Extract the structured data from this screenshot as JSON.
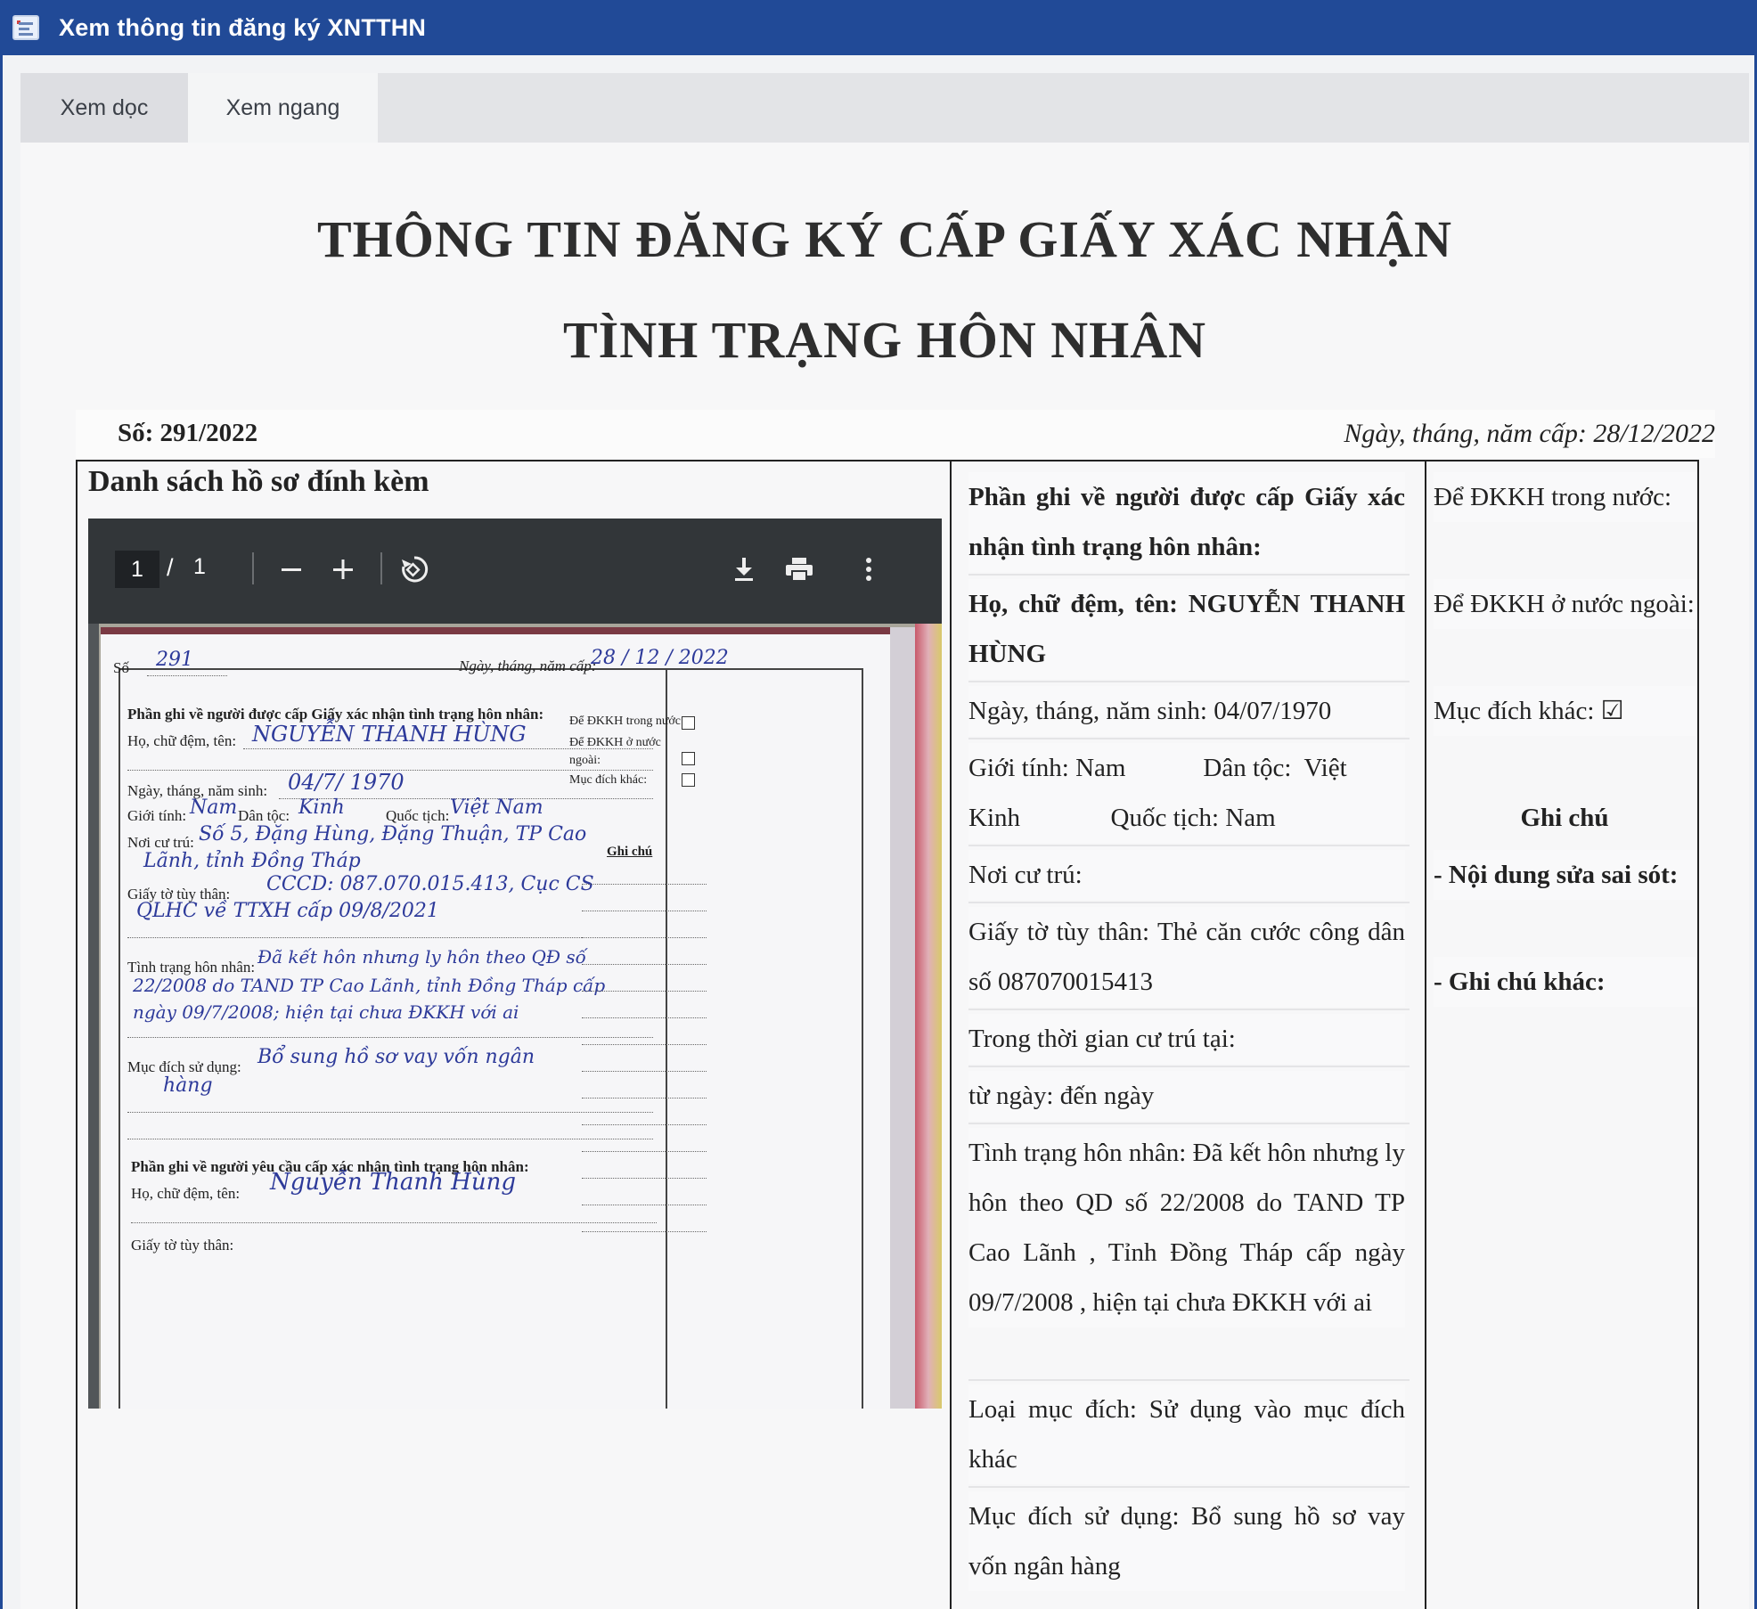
{
  "window": {
    "title": "Xem thông tin đăng ký XNTTHN"
  },
  "tabs": [
    {
      "label": "Xem dọc"
    },
    {
      "label": "Xem ngang"
    }
  ],
  "document": {
    "title_line1": "THÔNG TIN ĐĂNG KÝ CẤP GIẤY XÁC NHẬN",
    "title_line2": "TÌNH TRẠNG HÔN NHÂN",
    "so": "Số: 291/2022",
    "issue_date": "Ngày, tháng, năm cấp:  28/12/2022",
    "attachments_title": "Danh sách hồ sơ đính kèm"
  },
  "pdf_viewer": {
    "page_current": "1",
    "page_sep": "/",
    "page_total": "1",
    "icons": [
      "zoom-out-icon",
      "zoom-in-icon",
      "rotate-icon",
      "download-icon",
      "print-icon",
      "more-options-icon"
    ],
    "scan": {
      "so_label": "Số",
      "so_value": "291",
      "date_label": "Ngày, tháng, năm cấp:",
      "date_value": "28 / 12 / 2022",
      "section1": "Phần ghi về người được cấp Giấy xác nhận tình trạng hôn nhân:",
      "name_label": "Họ, chữ đệm, tên:",
      "name_value": "NGUYỄN THANH HÙNG",
      "dkkh_in": "Để ĐKKH trong nước:",
      "dkkh_out": "Để ĐKKH ở nước",
      "dkkh_out2": "ngoài:",
      "other_purpose": "Mục đích khác:",
      "dob_label": "Ngày, tháng, năm sinh:",
      "dob_value": "04/7/ 1970",
      "gender_label": "Giới tính:",
      "gender_value": "Nam",
      "ethnic_label": "Dân tộc:",
      "ethnic_value": "Kinh",
      "nation_label": "Quốc tịch:",
      "nation_value": "Việt Nam",
      "residence_label": "Nơi cư trú:",
      "residence_line1": "Số 5, Đặng Hùng, Đặng Thuận, TP Cao",
      "residence_line2": "Lãnh, tỉnh Đồng Tháp",
      "ghichu_label": "Ghi chú",
      "id_label": "Giấy tờ tùy thân:",
      "id_line1": "CCCD: 087.070.015.413, Cục CS",
      "id_line2": "QLHC về TTXH cấp 09/8/2021",
      "marital_label": "Tình trạng hôn nhân:",
      "marital_line1": "Đã kết hôn nhưng ly hôn theo QĐ số",
      "marital_line2": "22/2008 do TAND TP Cao Lãnh, tỉnh Đồng Tháp cấp",
      "marital_line3": "ngày 09/7/2008; hiện tại chưa ĐKKH với ai",
      "purpose_label": "Mục đích sử dụng:",
      "purpose_line1": "Bổ sung hồ sơ vay vốn ngân",
      "purpose_line2": "hàng",
      "section2": "Phần ghi về người yêu cầu cấp xác nhận tình trạng hôn nhân:",
      "req_name_label": "Họ, chữ đệm, tên:",
      "req_name_value": "Nguyễn Thanh Hùng",
      "req_id_label": "Giấy tờ tùy thân:"
    }
  },
  "info": {
    "section_title": "Phần ghi về người được cấp Giấy xác nhận tình trạng hôn nhân:",
    "name": "Họ, chữ đệm, tên: NGUYỄN THANH HÙNG",
    "dob": "Ngày, tháng, năm sinh: 04/07/1970",
    "gender_line1": "Giới tính: Nam            Dân tộc:  Việt",
    "gender_line2": "Kinh              Quốc tịch: Nam",
    "residence": "Nơi cư trú:",
    "id_doc": "Giấy tờ tùy thân: Thẻ căn cước công dân  số 087070015413",
    "stay_period": "Trong thời gian cư trú tại:",
    "from_to": "từ ngày:  đến ngày",
    "marital": "Tình trạng hôn nhân: Đã kết hôn nhưng ly hôn theo QD số 22/2008 do TAND TP Cao Lãnh , Tỉnh Đồng Tháp cấp ngày 09/7/2008 , hiện tại chưa ĐKKH với ai",
    "purpose_type": "Loại mục đích: Sử dụng vào mục đích khác",
    "purpose_use": "Mục đích sử dụng: Bổ sung hồ sơ vay vốn ngân hàng"
  },
  "side": {
    "dkkh_in": "Để  ĐKKH  trong nước:",
    "dkkh_out": "Để ĐKKH ở nước ngoài:",
    "other_purpose": "Mục đích khác: ☑",
    "notes_title": "Ghi chú",
    "correction": "- Nội dung sửa sai sót:",
    "other_notes": "- Ghi chú khác:"
  }
}
